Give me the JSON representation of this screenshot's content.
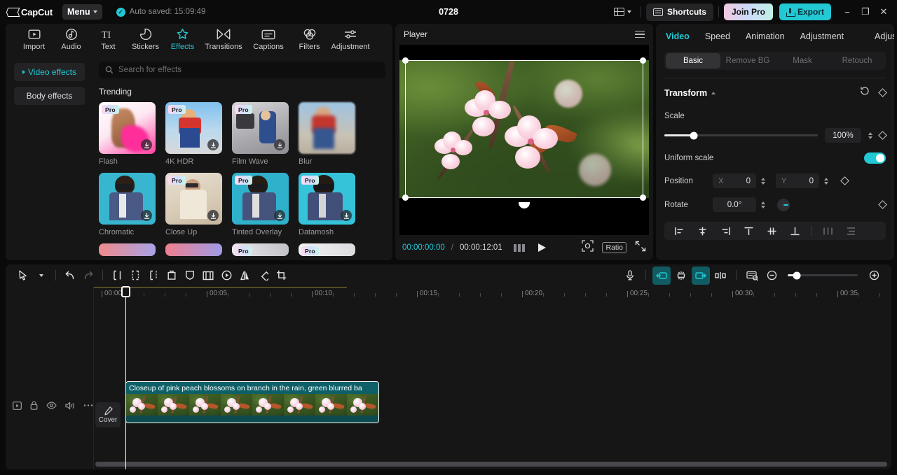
{
  "titlebar": {
    "brand": "CapCut",
    "menu_label": "Menu",
    "autosave_text": "Auto saved: 15:09:49",
    "project_title": "0728",
    "shortcuts_label": "Shortcuts",
    "join_pro_label": "Join Pro",
    "export_label": "Export",
    "minimize": "−",
    "maximize": "❐",
    "close": "✕"
  },
  "tools": {
    "tabs": [
      {
        "label": "Import",
        "icon": "import-icon",
        "active": false
      },
      {
        "label": "Audio",
        "icon": "audio-icon",
        "active": false
      },
      {
        "label": "Text",
        "icon": "text-icon",
        "active": false
      },
      {
        "label": "Stickers",
        "icon": "stickers-icon",
        "active": false
      },
      {
        "label": "Effects",
        "icon": "effects-icon",
        "active": true
      },
      {
        "label": "Transitions",
        "icon": "transitions-icon",
        "active": false
      },
      {
        "label": "Captions",
        "icon": "captions-icon",
        "active": false
      },
      {
        "label": "Filters",
        "icon": "filters-icon",
        "active": false
      },
      {
        "label": "Adjustment",
        "icon": "adjustment-icon",
        "active": false
      }
    ]
  },
  "effects_panel": {
    "sidebar": [
      {
        "label": "Video effects",
        "active": true
      },
      {
        "label": "Body effects",
        "active": false
      }
    ],
    "search_placeholder": "Search for effects",
    "search_value": "",
    "section_title": "Trending",
    "cards": [
      {
        "name": "Flash",
        "pro": true,
        "download": true
      },
      {
        "name": "4K HDR",
        "pro": true,
        "download": true
      },
      {
        "name": "Film Wave",
        "pro": true,
        "download": true
      },
      {
        "name": "Blur",
        "pro": false,
        "download": false
      },
      {
        "name": "Chromatic",
        "pro": false,
        "download": true
      },
      {
        "name": "Close Up",
        "pro": true,
        "download": true
      },
      {
        "name": "Tinted Overlay",
        "pro": true,
        "download": true
      },
      {
        "name": "Datamosh",
        "pro": true,
        "download": true
      }
    ],
    "partial_row": [
      {
        "pro": false
      },
      {
        "pro": false
      },
      {
        "pro": true
      },
      {
        "pro": true
      }
    ]
  },
  "player": {
    "title": "Player",
    "current_time": "00:00:00:00",
    "time_separator": "/",
    "total_time": "00:00:12:01",
    "ratio_label": "Ratio",
    "icons": [
      "menu-icon",
      "frames-icon",
      "play-icon",
      "zoom-fit-icon",
      "fullscreen-icon"
    ]
  },
  "inspector": {
    "tabs": [
      {
        "label": "Video",
        "active": true
      },
      {
        "label": "Speed",
        "active": false
      },
      {
        "label": "Animation",
        "active": false
      },
      {
        "label": "Adjustment",
        "active": false
      },
      {
        "label": "Adjust",
        "active": false
      }
    ],
    "segments": [
      {
        "label": "Basic",
        "active": true
      },
      {
        "label": "Remove BG",
        "active": false
      },
      {
        "label": "Mask",
        "active": false
      },
      {
        "label": "Retouch",
        "active": false
      }
    ],
    "transform": {
      "title": "Transform",
      "scale_label": "Scale",
      "scale_value": "100%",
      "uniform_scale_label": "Uniform scale",
      "uniform_scale_on": true,
      "position_label": "Position",
      "position_x_axis": "X",
      "position_x": "0",
      "position_y_axis": "Y",
      "position_y": "0",
      "rotate_label": "Rotate",
      "rotate_value": "0.0°"
    },
    "align_buttons": [
      "align-left-icon",
      "align-center-horizontal-icon",
      "align-right-icon",
      "align-top-icon",
      "align-middle-vertical-icon",
      "align-bottom-icon",
      "distribute-horizontal-icon",
      "distribute-vertical-icon"
    ]
  },
  "timeline": {
    "toolbar_left": [
      "select-icon",
      "select-dropdown",
      "undo-icon",
      "redo-icon",
      "split-icon",
      "trim-left-icon",
      "trim-right-icon",
      "delete-icon",
      "shield-icon",
      "freeze-icon",
      "speed-icon",
      "mirror-icon",
      "rotate-icon",
      "crop-icon"
    ],
    "toolbar_right": [
      "microphone-icon",
      "snap-start-icon",
      "auto-fit-icon",
      "snap-end-icon",
      "keyframe-icon",
      "preview-icon",
      "zoom-out-icon",
      "zoom-slider",
      "zoom-in-icon"
    ],
    "ruler_labels": [
      "00:00",
      "00:05",
      "00:10",
      "00:15",
      "00:20",
      "00:25",
      "00:30",
      "00:35"
    ],
    "playhead_time": "00:00",
    "track_controls": [
      "video-track-icon",
      "lock-icon",
      "eye-icon",
      "volume-icon",
      "more-icon"
    ],
    "cover_label": "Cover",
    "clip": {
      "caption": "Closeup of pink peach blossoms on branch in the rain, green blurred ba",
      "thumb_count": 8
    }
  },
  "colors": {
    "accent": "#22c9d4",
    "panel_bg": "#161617",
    "app_bg": "#0a0a0a",
    "clip_teal": "#0e6068"
  }
}
